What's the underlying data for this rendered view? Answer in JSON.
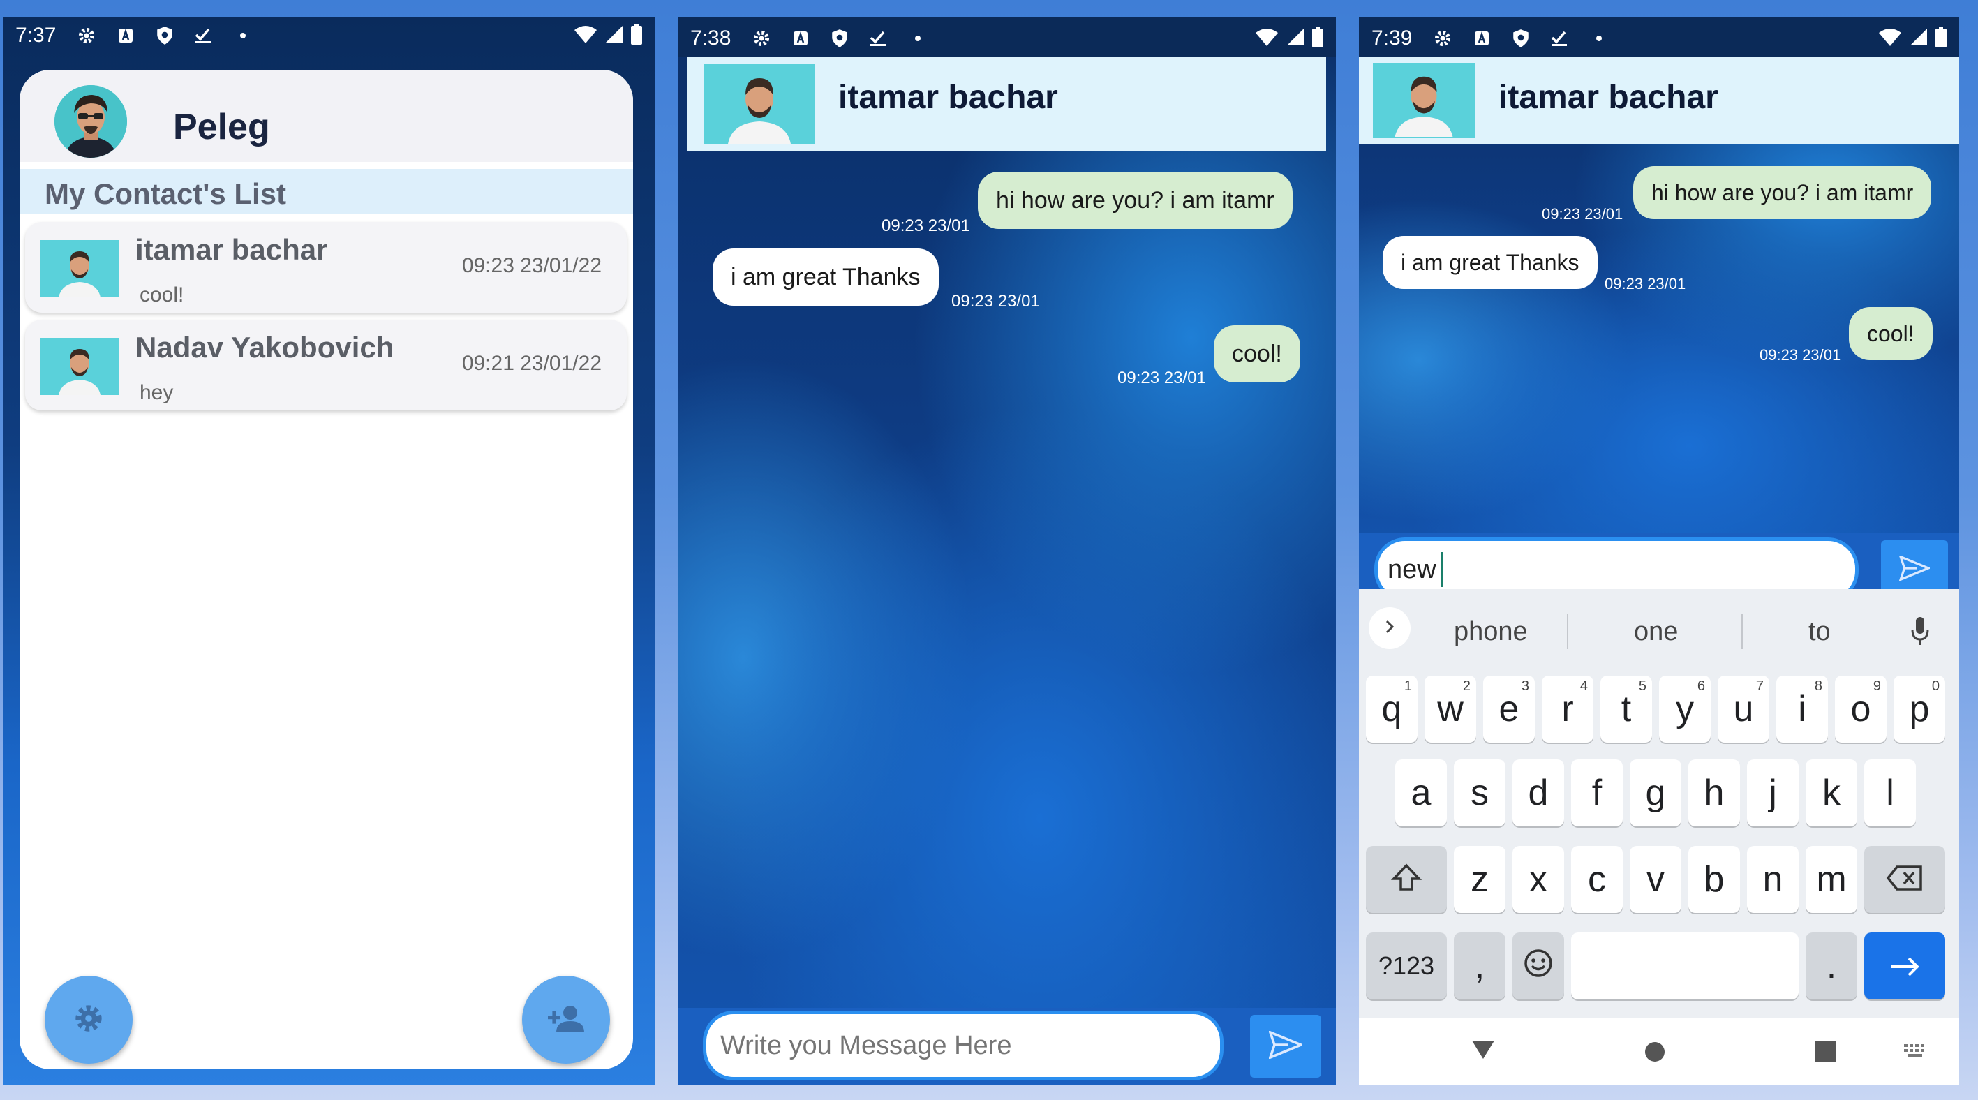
{
  "phone1": {
    "status": {
      "time": "7:37"
    },
    "header": {
      "name": "Peleg"
    },
    "list_title": "My Contact's List",
    "contacts": [
      {
        "name": "itamar bachar",
        "last_message": "cool!",
        "time": "09:23 23/01/22"
      },
      {
        "name": "Nadav Yakobovich",
        "last_message": "hey",
        "time": "09:21 23/01/22"
      }
    ],
    "fab_left_icon": "gear-icon",
    "fab_right_icon": "add-person-icon"
  },
  "phone2": {
    "status": {
      "time": "7:38"
    },
    "chat_name": "itamar bachar",
    "messages": [
      {
        "text": "hi how are you? i am itamr",
        "time": "09:23 23/01",
        "direction": "out"
      },
      {
        "text": "i am great Thanks",
        "time": "09:23 23/01",
        "direction": "in"
      },
      {
        "text": "cool!",
        "time": "09:23 23/01",
        "direction": "out"
      }
    ],
    "input_placeholder": "Write you Message Here",
    "send_icon": "send-icon"
  },
  "phone3": {
    "status": {
      "time": "7:39"
    },
    "chat_name": "itamar bachar",
    "messages": [
      {
        "text": "hi how are you? i am itamr",
        "time": "09:23 23/01",
        "direction": "out"
      },
      {
        "text": "i am great Thanks",
        "time": "09:23 23/01",
        "direction": "in"
      },
      {
        "text": "cool!",
        "time": "09:23 23/01",
        "direction": "out"
      }
    ],
    "input_value": "new",
    "keyboard": {
      "suggestions": [
        "phone",
        "one",
        "to"
      ],
      "row1": [
        "q",
        "w",
        "e",
        "r",
        "t",
        "y",
        "u",
        "i",
        "o",
        "p"
      ],
      "row1_nums": [
        "1",
        "2",
        "3",
        "4",
        "5",
        "6",
        "7",
        "8",
        "9",
        "0"
      ],
      "row2": [
        "a",
        "s",
        "d",
        "f",
        "g",
        "h",
        "j",
        "k",
        "l"
      ],
      "row3": [
        "z",
        "x",
        "c",
        "v",
        "b",
        "n",
        "m"
      ],
      "symbols_label": "?123",
      "comma": ",",
      "period": "."
    }
  },
  "colors": {
    "accent": "#2c8ef0",
    "fab": "#5fa8ee",
    "out_bubble": "#d6edd0",
    "header": "#dff3fc"
  }
}
